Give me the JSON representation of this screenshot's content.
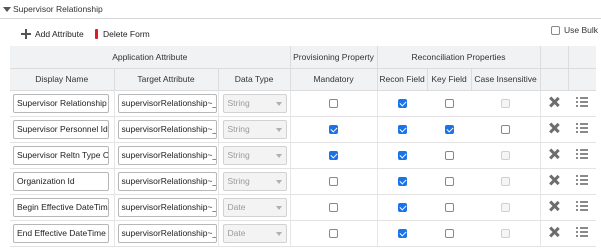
{
  "section": {
    "title": "Supervisor Relationship"
  },
  "toolbar": {
    "add_label": "Add Attribute",
    "delete_label": "Delete Form",
    "bulk_label": "Use Bulk"
  },
  "columns": {
    "group_app": "Application Attribute",
    "group_prov": "Provisioning Property",
    "group_recon": "Reconciliation Properties",
    "display_name": "Display Name",
    "target_attribute": "Target Attribute",
    "data_type": "Data Type",
    "mandatory": "Mandatory",
    "recon_field": "Recon Field",
    "key_field": "Key Field",
    "case_insensitive": "Case Insensitive"
  },
  "rows": [
    {
      "display_name": "Supervisor Relationship Pr",
      "target": "supervisorRelationship~__",
      "data_type": "String"
    },
    {
      "display_name": "Supervisor Personnel Id",
      "target": "supervisorRelationship~__",
      "data_type": "String"
    },
    {
      "display_name": "Supervisor Reltn Type Coc",
      "target": "supervisorRelationship~__",
      "data_type": "String"
    },
    {
      "display_name": "Organization Id",
      "target": "supervisorRelationship~__",
      "data_type": "String"
    },
    {
      "display_name": "Begin Effective DateTime",
      "target": "supervisorRelationship~__",
      "data_type": "Date"
    },
    {
      "display_name": "End Effective DateTime",
      "target": "supervisorRelationship~__",
      "data_type": "Date"
    }
  ],
  "checkbox_states": {
    "mandatory": [
      false,
      true,
      true,
      false,
      false,
      false
    ],
    "recon_field": [
      true,
      true,
      true,
      true,
      true,
      true
    ],
    "key_field": [
      false,
      true,
      false,
      false,
      false,
      false
    ],
    "case_insensitive_enabled": [
      false,
      true,
      false,
      false,
      false,
      false
    ]
  },
  "colors": {
    "accent": "#1a73e8",
    "delete_marker": "#e0182d",
    "header_bg": "#f1f2f3"
  },
  "icons": {
    "add": "plus-icon",
    "delete_form": "red-bar-icon",
    "row_delete": "close-icon",
    "row_options": "list-icon"
  }
}
